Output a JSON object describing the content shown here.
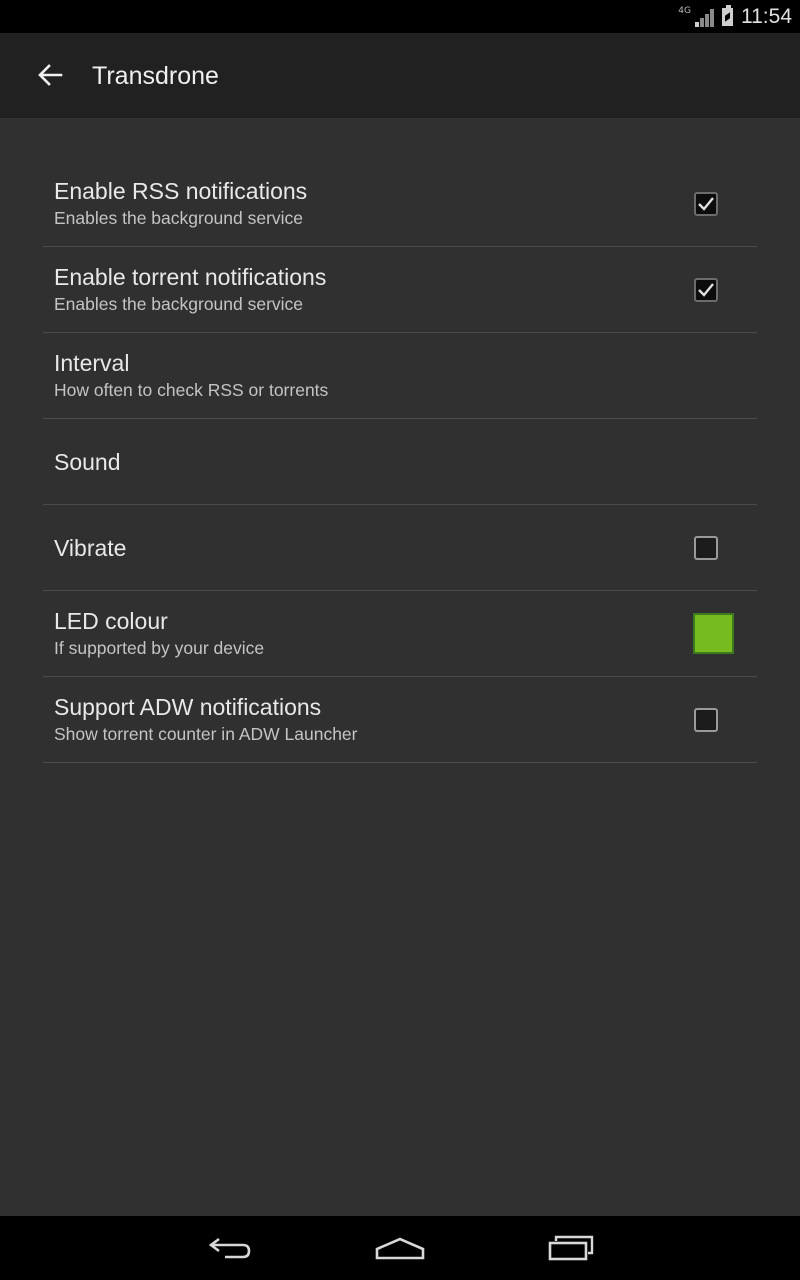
{
  "status_bar": {
    "network": "4G",
    "time": "11:54"
  },
  "action_bar": {
    "title": "Transdrone",
    "back_icon": "arrow-left-icon"
  },
  "preferences": [
    {
      "title": "Enable RSS notifications",
      "summary": "Enables the background service",
      "widget": "checkbox",
      "checked": true
    },
    {
      "title": "Enable torrent notifications",
      "summary": "Enables the background service",
      "widget": "checkbox",
      "checked": true
    },
    {
      "title": "Interval",
      "summary": "How often to check RSS or torrents",
      "widget": "none"
    },
    {
      "title": "Sound",
      "summary": "",
      "widget": "none"
    },
    {
      "title": "Vibrate",
      "summary": "",
      "widget": "checkbox",
      "checked": false
    },
    {
      "title": "LED colour",
      "summary": "If supported by your device",
      "widget": "color",
      "color": "#76bc21"
    },
    {
      "title": "Support ADW notifications",
      "summary": "Show torrent counter in ADW Launcher",
      "widget": "checkbox",
      "checked": false
    }
  ],
  "nav_bar": {
    "back_icon": "back-icon",
    "home_icon": "home-icon",
    "recents_icon": "recents-icon"
  }
}
